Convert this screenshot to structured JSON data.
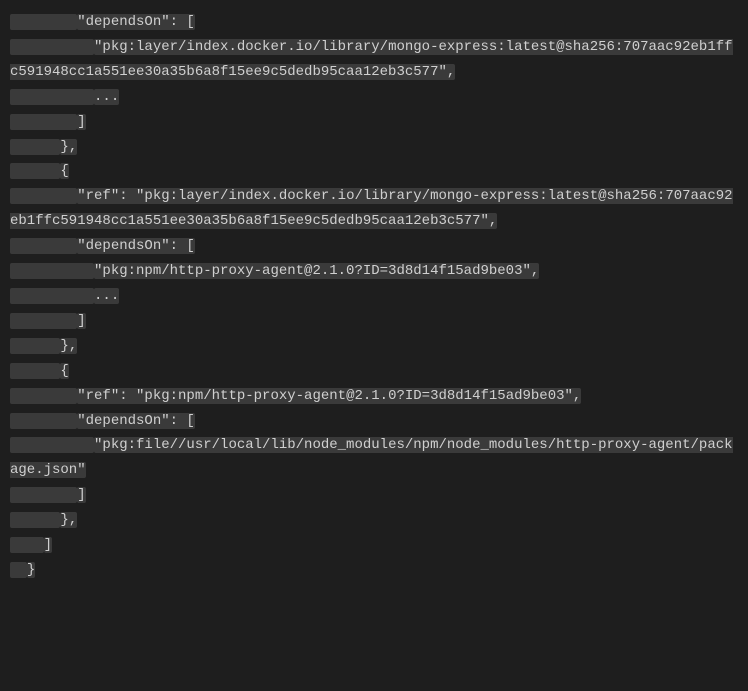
{
  "code": {
    "lines": [
      {
        "indent": "        ",
        "text": "\"dependsOn\": ["
      },
      {
        "indent": "          ",
        "text": "\"pkg:layer/index.docker.io/library/mongo-express:latest@sha256:707aac92eb1ffc591948cc1a551ee30a35b6a8f15ee9c5dedb95caa12eb3c577\","
      },
      {
        "indent": "          ",
        "text": "..."
      },
      {
        "indent": "        ",
        "text": "]"
      },
      {
        "indent": "      ",
        "text": "},"
      },
      {
        "indent": "      ",
        "text": "{"
      },
      {
        "indent": "        ",
        "text": "\"ref\": \"pkg:layer/index.docker.io/library/mongo-express:latest@sha256:707aac92eb1ffc591948cc1a551ee30a35b6a8f15ee9c5dedb95caa12eb3c577\","
      },
      {
        "indent": "        ",
        "text": "\"dependsOn\": ["
      },
      {
        "indent": "          ",
        "text": "\"pkg:npm/http-proxy-agent@2.1.0?ID=3d8d14f15ad9be03\","
      },
      {
        "indent": "          ",
        "text": "..."
      },
      {
        "indent": "        ",
        "text": "]"
      },
      {
        "indent": "      ",
        "text": "},"
      },
      {
        "indent": "      ",
        "text": "{"
      },
      {
        "indent": "        ",
        "text": "\"ref\": \"pkg:npm/http-proxy-agent@2.1.0?ID=3d8d14f15ad9be03\","
      },
      {
        "indent": "        ",
        "text": "\"dependsOn\": ["
      },
      {
        "indent": "          ",
        "text": "\"pkg:file//usr/local/lib/node_modules/npm/node_modules/http-proxy-agent/package.json\""
      },
      {
        "indent": "        ",
        "text": "]"
      },
      {
        "indent": "      ",
        "text": "},"
      },
      {
        "indent": "    ",
        "text": "]"
      },
      {
        "indent": "  ",
        "text": "}"
      }
    ]
  }
}
